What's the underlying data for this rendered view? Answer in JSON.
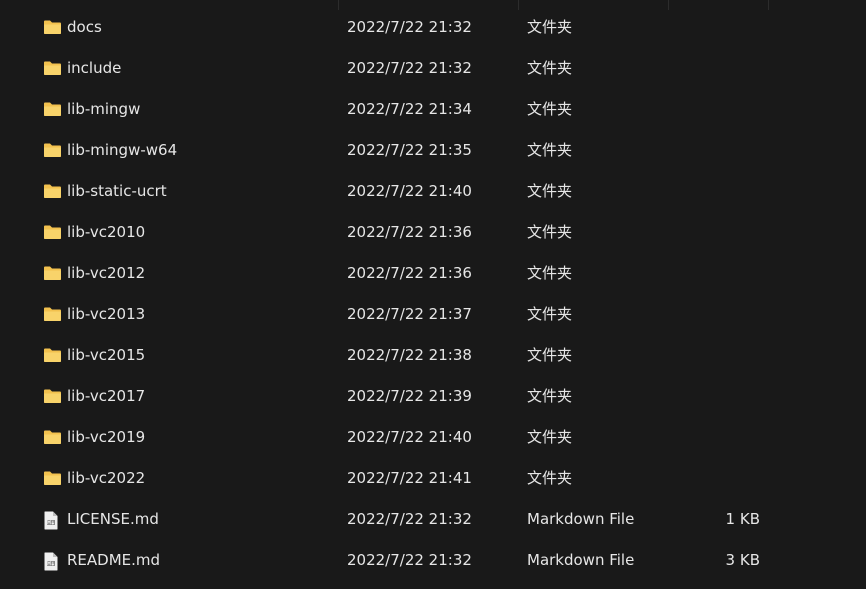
{
  "files": [
    {
      "name": "docs",
      "modified": "2022/7/22 21:32",
      "type": "文件夹",
      "size": "",
      "icon": "folder-icon"
    },
    {
      "name": "include",
      "modified": "2022/7/22 21:32",
      "type": "文件夹",
      "size": "",
      "icon": "folder-icon"
    },
    {
      "name": "lib-mingw",
      "modified": "2022/7/22 21:34",
      "type": "文件夹",
      "size": "",
      "icon": "folder-icon"
    },
    {
      "name": "lib-mingw-w64",
      "modified": "2022/7/22 21:35",
      "type": "文件夹",
      "size": "",
      "icon": "folder-icon"
    },
    {
      "name": "lib-static-ucrt",
      "modified": "2022/7/22 21:40",
      "type": "文件夹",
      "size": "",
      "icon": "folder-icon"
    },
    {
      "name": "lib-vc2010",
      "modified": "2022/7/22 21:36",
      "type": "文件夹",
      "size": "",
      "icon": "folder-icon"
    },
    {
      "name": "lib-vc2012",
      "modified": "2022/7/22 21:36",
      "type": "文件夹",
      "size": "",
      "icon": "folder-icon"
    },
    {
      "name": "lib-vc2013",
      "modified": "2022/7/22 21:37",
      "type": "文件夹",
      "size": "",
      "icon": "folder-icon"
    },
    {
      "name": "lib-vc2015",
      "modified": "2022/7/22 21:38",
      "type": "文件夹",
      "size": "",
      "icon": "folder-icon"
    },
    {
      "name": "lib-vc2017",
      "modified": "2022/7/22 21:39",
      "type": "文件夹",
      "size": "",
      "icon": "folder-icon"
    },
    {
      "name": "lib-vc2019",
      "modified": "2022/7/22 21:40",
      "type": "文件夹",
      "size": "",
      "icon": "folder-icon"
    },
    {
      "name": "lib-vc2022",
      "modified": "2022/7/22 21:41",
      "type": "文件夹",
      "size": "",
      "icon": "folder-icon"
    },
    {
      "name": "LICENSE.md",
      "modified": "2022/7/22 21:32",
      "type": "Markdown File",
      "size": "1 KB",
      "icon": "markdown-file-icon"
    },
    {
      "name": "README.md",
      "modified": "2022/7/22 21:32",
      "type": "Markdown File",
      "size": "3 KB",
      "icon": "markdown-file-icon"
    }
  ],
  "colors": {
    "background": "#191919",
    "text": "#e6e6e6",
    "folder": "#f2c14e",
    "file": "#f0f0f0"
  }
}
